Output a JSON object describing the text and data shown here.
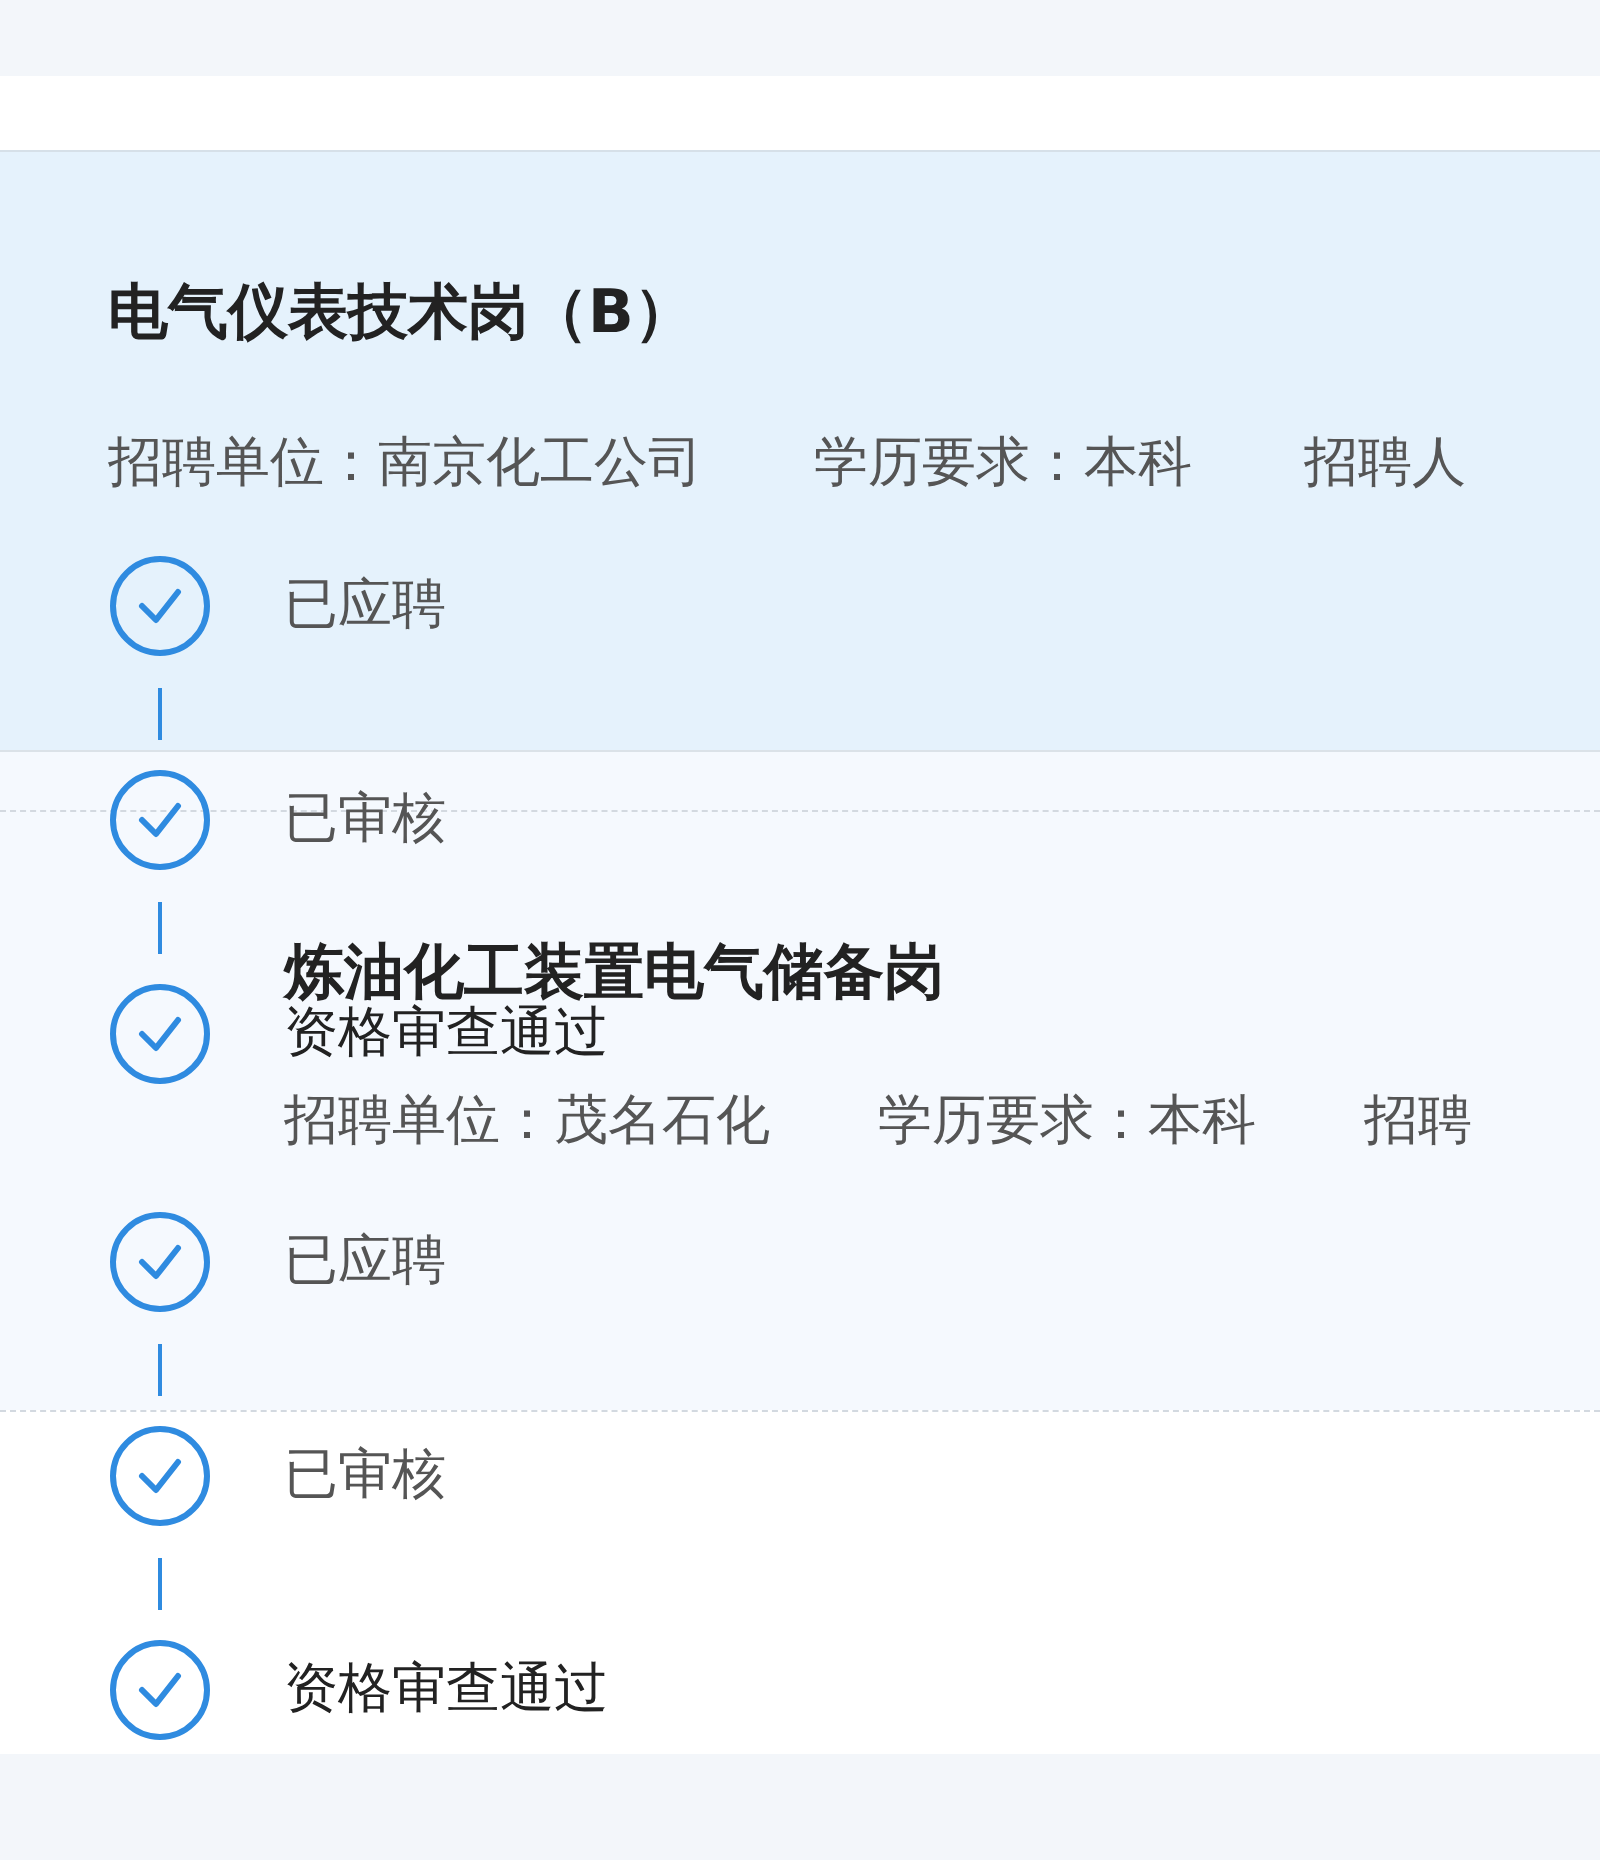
{
  "positions": [
    {
      "title": "电气仪表技术岗（B）",
      "fields": [
        "招聘单位：南京化工公司",
        "学历要求：本科",
        "招聘人"
      ],
      "steps": [
        {
          "label": "已应聘",
          "done": true,
          "current": false
        },
        {
          "label": "已审核",
          "done": true,
          "current": false
        },
        {
          "label": "资格审查通过",
          "done": true,
          "current": true
        }
      ]
    },
    {
      "title": "炼油化工装置电气储备岗",
      "fields": [
        "招聘单位：茂名石化",
        "学历要求：本科",
        "招聘"
      ],
      "steps": [
        {
          "label": "已应聘",
          "done": true,
          "current": false
        },
        {
          "label": "已审核",
          "done": true,
          "current": false
        },
        {
          "label": "资格审查通过",
          "done": true,
          "current": true
        }
      ]
    }
  ]
}
